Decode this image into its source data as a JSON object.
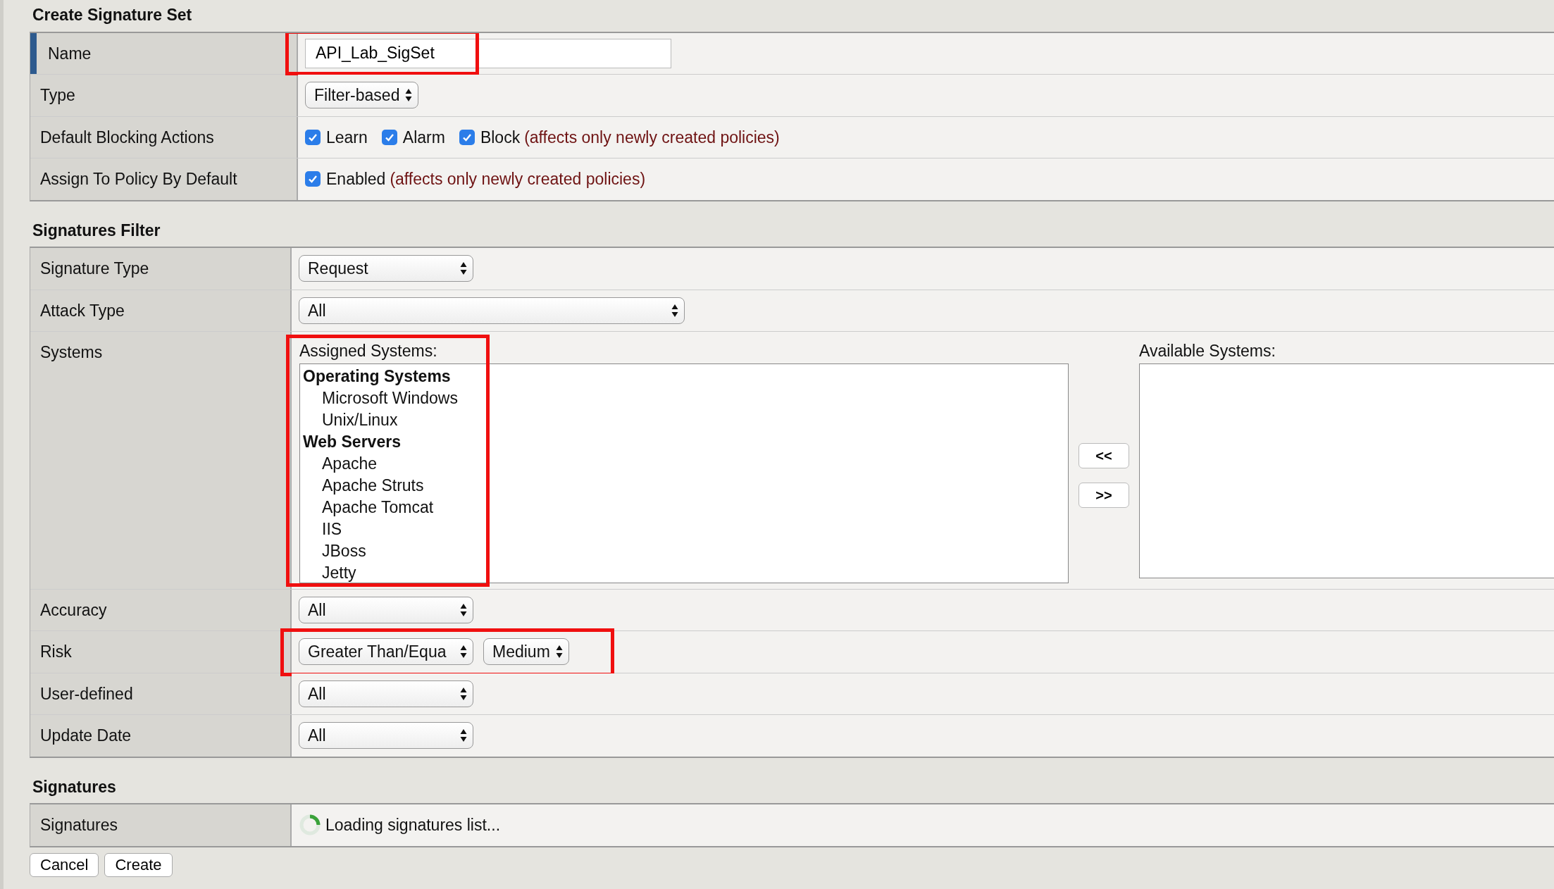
{
  "sections": [
    {
      "title": "Create Signature Set",
      "rows": [
        {
          "label": "Name",
          "kind": "text",
          "value": "API_Lab_SigSet",
          "accent": true,
          "highlighted": true
        },
        {
          "label": "Type",
          "kind": "select",
          "selects": [
            {
              "value": "Filter-based"
            }
          ],
          "accent": false,
          "highlighted": false
        },
        {
          "label": "Default Blocking Actions",
          "kind": "checks",
          "checks": [
            {
              "label": "Learn",
              "checked": true
            },
            {
              "label": "Alarm",
              "checked": true
            },
            {
              "label": "Block",
              "checked": true
            }
          ],
          "note": "(affects only newly created policies)",
          "accent": false,
          "highlighted": false
        },
        {
          "label": "Assign To Policy By Default",
          "kind": "checks",
          "checks": [
            {
              "label": "Enabled",
              "checked": true
            }
          ],
          "note": "(affects only newly created policies)",
          "accent": false,
          "highlighted": false
        }
      ]
    },
    {
      "title": "Signatures Filter",
      "rows": [
        {
          "label": "Signature Type",
          "kind": "select",
          "selects": [
            {
              "value": "Request"
            }
          ],
          "accent": false,
          "highlighted": false
        },
        {
          "label": "Attack Type",
          "kind": "select",
          "selects": [
            {
              "value": "All"
            }
          ],
          "accent": false,
          "highlighted": false
        },
        {
          "label": "Systems",
          "kind": "systems",
          "accent": false,
          "highlighted": true,
          "assigned": {
            "label": "Assigned Systems:",
            "groups": [
              {
                "name": "Operating Systems",
                "children": [
                  "Microsoft Windows",
                  "Unix/Linux"
                ]
              },
              {
                "name": "Web Servers",
                "children": [
                  "Apache",
                  "Apache Struts",
                  "Apache Tomcat",
                  "IIS",
                  "JBoss",
                  "Jetty"
                ]
              }
            ]
          },
          "move_buttons": [
            "<<",
            ">>"
          ],
          "available": {
            "label": "Available Systems:"
          }
        },
        {
          "label": "Accuracy",
          "kind": "select",
          "selects": [
            {
              "value": "All"
            }
          ],
          "accent": false,
          "highlighted": false
        },
        {
          "label": "Risk",
          "kind": "select",
          "selects": [
            {
              "value": "Greater Than/Equa"
            },
            {
              "value": "Medium"
            }
          ],
          "accent": false,
          "highlighted": true
        },
        {
          "label": "User-defined",
          "kind": "select",
          "selects": [
            {
              "value": "All"
            }
          ],
          "accent": false,
          "highlighted": false
        },
        {
          "label": "Update Date",
          "kind": "select",
          "selects": [
            {
              "value": "All"
            }
          ],
          "accent": false,
          "highlighted": false
        }
      ]
    },
    {
      "title": "Signatures",
      "rows": [
        {
          "label": "Signatures",
          "kind": "loading",
          "value": "Loading signatures list...",
          "accent": false,
          "highlighted": false
        }
      ]
    }
  ],
  "buttons": [
    "Cancel",
    "Create"
  ]
}
